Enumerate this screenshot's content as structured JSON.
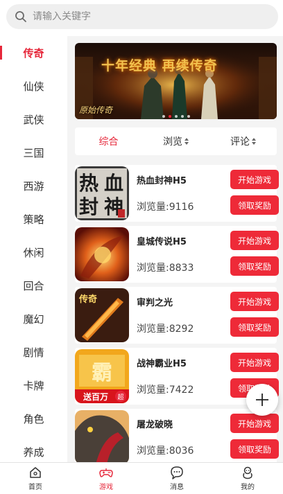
{
  "search": {
    "placeholder": "请输入关键字"
  },
  "sidebar": {
    "items": [
      {
        "label": "传奇",
        "active": true
      },
      {
        "label": "仙侠"
      },
      {
        "label": "武侠"
      },
      {
        "label": "三国"
      },
      {
        "label": "西游"
      },
      {
        "label": "策略"
      },
      {
        "label": "休闲"
      },
      {
        "label": "回合"
      },
      {
        "label": "魔幻"
      },
      {
        "label": "剧情"
      },
      {
        "label": "卡牌"
      },
      {
        "label": "角色"
      },
      {
        "label": "养成"
      }
    ]
  },
  "banner": {
    "title": "十年经典 再续传奇",
    "subtitle": "原始传奇",
    "slide_count": 5,
    "active_slide": 2
  },
  "tabs": [
    {
      "label": "综合",
      "active": true
    },
    {
      "label": "浏览"
    },
    {
      "label": "评论"
    }
  ],
  "games": [
    {
      "name": "热血封神H5",
      "views": "浏览量:9116",
      "icon": "rexue-fengshen-icon",
      "icon_text": [
        "热",
        "血",
        "封",
        "神"
      ]
    },
    {
      "name": "皇城传说H5",
      "views": "浏览量:8833",
      "icon": "huangcheng-chuanshuo-icon"
    },
    {
      "name": "审判之光",
      "views": "浏览量:8292",
      "icon": "shenpan-zhiguang-icon",
      "icon_text": [
        "传奇"
      ]
    },
    {
      "name": "战神霸业H5",
      "views": "浏览量:7422",
      "icon": "zhanshen-baye-icon",
      "icon_text": [
        "送百万",
        "超"
      ]
    },
    {
      "name": "屠龙破晓",
      "views": "浏览量:8036",
      "icon": "tulong-poxiao-icon"
    }
  ],
  "buttons": {
    "start": "开始游戏",
    "reward": "领取奖励"
  },
  "bottom_nav": [
    {
      "label": "首页",
      "icon": "home-icon"
    },
    {
      "label": "游戏",
      "icon": "gamepad-icon",
      "active": true
    },
    {
      "label": "消息",
      "icon": "message-icon"
    },
    {
      "label": "我的",
      "icon": "profile-icon"
    }
  ],
  "colors": {
    "accent": "#e6273a",
    "button": "#ee2a38",
    "panel_bg": "#f4f4f4"
  }
}
